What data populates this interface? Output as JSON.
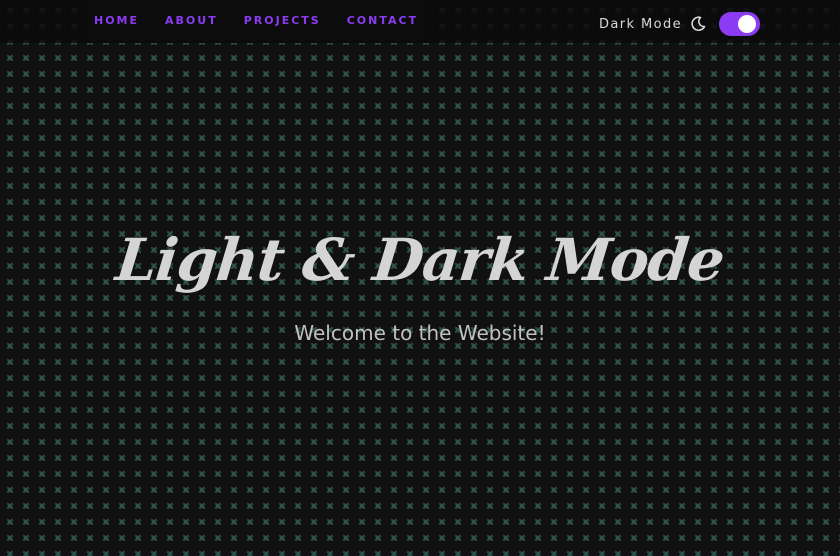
{
  "nav": {
    "links": [
      {
        "label": "HOME"
      },
      {
        "label": "ABOUT"
      },
      {
        "label": "PROJECTS"
      },
      {
        "label": "CONTACT"
      }
    ]
  },
  "theme_switch": {
    "label": "Dark Mode",
    "icon": "moon-icon",
    "checked": true
  },
  "hero": {
    "title": "Light & Dark Mode",
    "subtitle": "Welcome to the Website!"
  },
  "colors": {
    "accent": "#8c3bf5",
    "background": "#111111",
    "pattern": "#325a55",
    "text": "#d4d4d4"
  }
}
